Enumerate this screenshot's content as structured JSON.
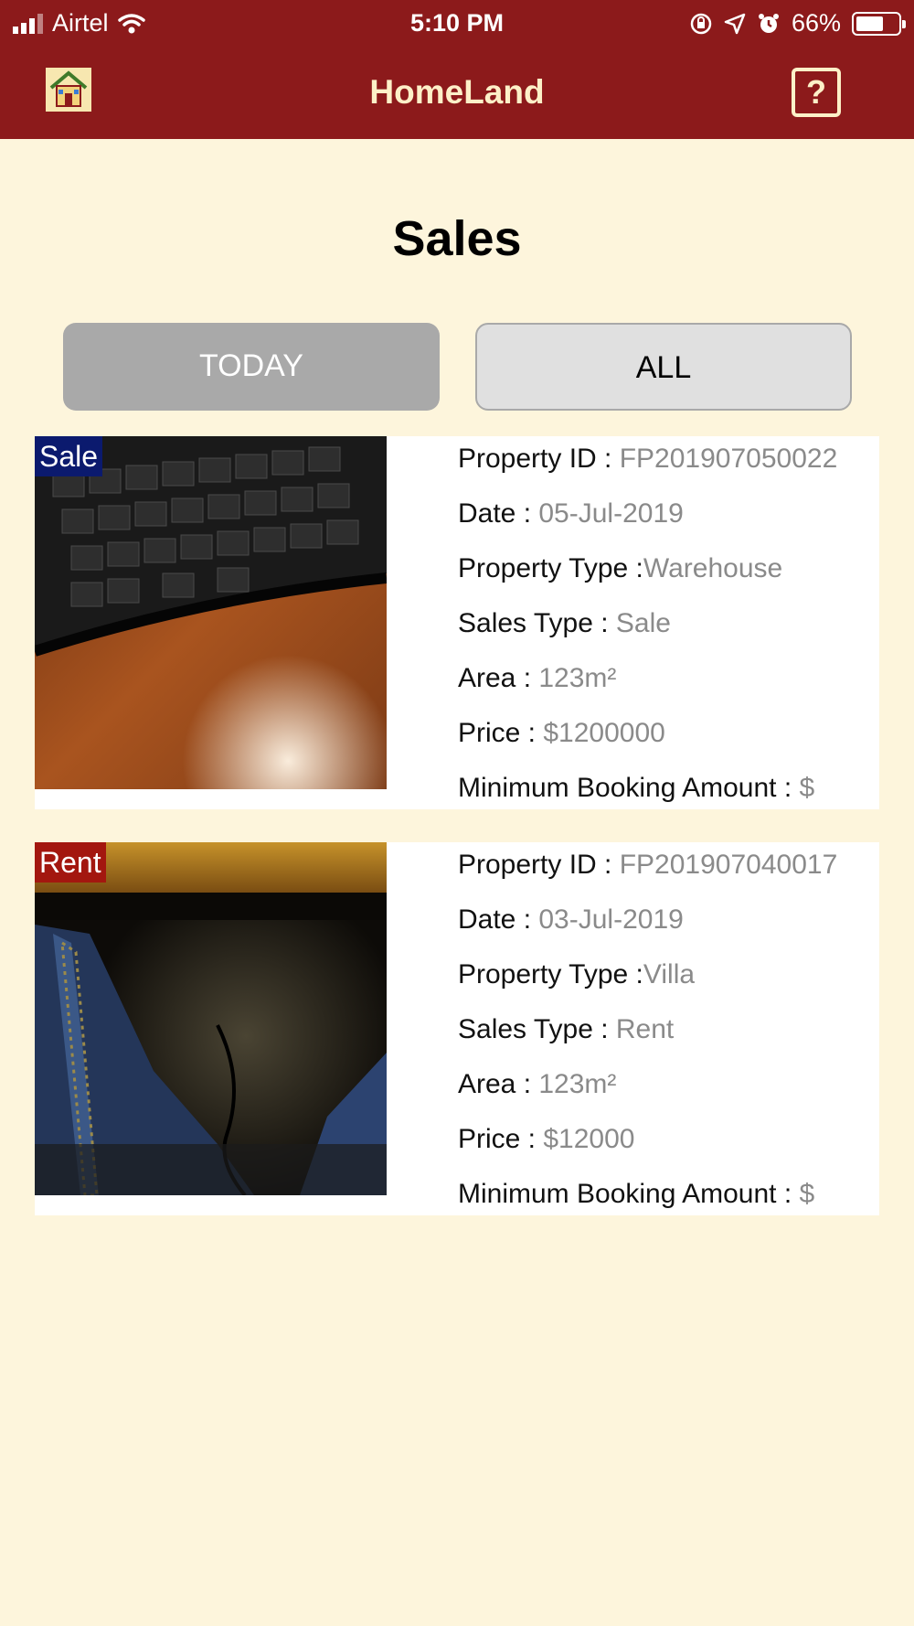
{
  "status_bar": {
    "carrier": "Airtel",
    "time": "5:10 PM",
    "battery_percent": "66%",
    "battery_level": 0.66
  },
  "header": {
    "title": "HomeLand",
    "help_label": "?"
  },
  "page": {
    "title": "Sales"
  },
  "filter": {
    "today_label": "TODAY",
    "all_label": "ALL",
    "selected": "TODAY"
  },
  "labels": {
    "property_id": "Property ID : ",
    "date": "Date : ",
    "property_type": "Property Type :",
    "sales_type": "Sales Type :  ",
    "area": "Area :  ",
    "price": "Price : ",
    "min_booking": "Minimum Booking Amount : "
  },
  "listings": [
    {
      "badge": "Sale",
      "badge_color": "#0b1a6e",
      "property_id": "FP201907050022",
      "date": "05-Jul-2019",
      "property_type": "Warehouse",
      "sales_type": "Sale",
      "area": "123m²",
      "price": "$1200000",
      "min_booking": "$"
    },
    {
      "badge": "Rent",
      "badge_color": "#a3170f",
      "property_id": "FP201907040017",
      "date": "03-Jul-2019",
      "property_type": "Villa",
      "sales_type": "Rent",
      "area": "123m²",
      "price": "$12000",
      "min_booking": "$"
    }
  ],
  "icons": {
    "signal": "signal-bars-icon",
    "wifi": "wifi-icon",
    "orientation_lock": "orientation-lock-icon",
    "location": "location-arrow-icon",
    "alarm": "alarm-icon",
    "battery": "battery-icon",
    "logo": "house-logo-icon",
    "help": "help-icon"
  }
}
